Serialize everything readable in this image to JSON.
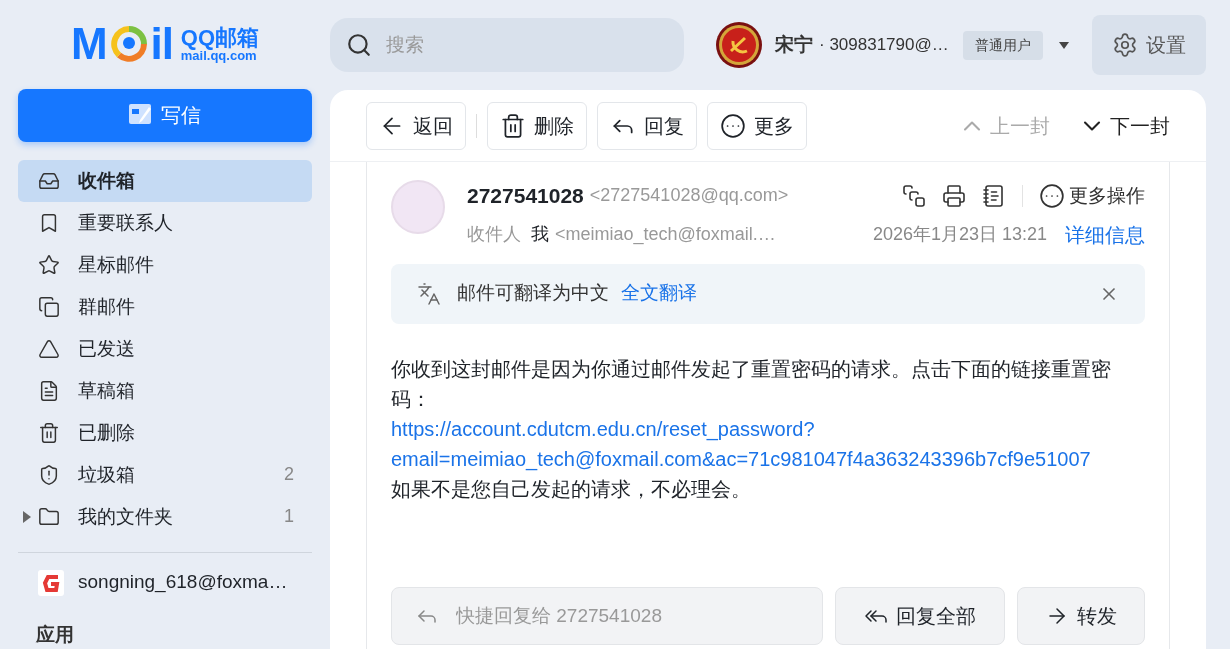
{
  "logo": {
    "left": "M",
    "right": "il",
    "name": "QQ邮箱",
    "domain": "mail.qq.com"
  },
  "search": {
    "placeholder": "搜索"
  },
  "user": {
    "name": "宋宁",
    "account": "· 309831790@…",
    "badge": "普通用户"
  },
  "settings": {
    "label": "设置"
  },
  "compose": {
    "label": "写信"
  },
  "folders": [
    {
      "kind": "inbox",
      "label": "收件箱",
      "selected": true
    },
    {
      "kind": "important",
      "label": "重要联系人",
      "selected": false
    },
    {
      "kind": "starred",
      "label": "星标邮件",
      "selected": false
    },
    {
      "kind": "group",
      "label": "群邮件",
      "selected": false
    },
    {
      "kind": "sent",
      "label": "已发送",
      "selected": false
    },
    {
      "kind": "drafts",
      "label": "草稿箱",
      "selected": false
    },
    {
      "kind": "deleted",
      "label": "已删除",
      "selected": false
    },
    {
      "kind": "spam",
      "label": "垃圾箱",
      "selected": false,
      "count": "2"
    },
    {
      "kind": "folder",
      "label": "我的文件夹",
      "selected": false,
      "count": "1",
      "expanded": false
    }
  ],
  "other_account": {
    "label": "songning_618@foxma…"
  },
  "apps_heading": "应用",
  "toolbar": {
    "buttons": [
      {
        "kind": "back",
        "label": "返回"
      },
      {
        "kind": "delete",
        "label": "删除"
      },
      {
        "kind": "reply",
        "label": "回复"
      },
      {
        "kind": "more",
        "label": "更多"
      }
    ],
    "nav": [
      {
        "kind": "prev",
        "label": "上一封",
        "disabled": true
      },
      {
        "kind": "next",
        "label": "下一封",
        "disabled": false
      }
    ]
  },
  "email": {
    "sender": "2727541028",
    "sender_address": "<2727541028@qq.com>",
    "more_actions": "更多操作",
    "to_label": "收件人",
    "to_name": "我",
    "to_address": "<meimiao_tech@foxmail.…",
    "date": "2026年1月23日 13:21",
    "details": "详细信息",
    "translate": {
      "text": "邮件可翻译为中文",
      "action": "全文翻译"
    },
    "body": [
      {
        "kind": "text",
        "text": "你收到这封邮件是因为你通过邮件发起了重置密码的请求。点击下面的链接重置密码："
      },
      {
        "kind": "link",
        "text": "https://account.cdutcm.edu.cn/reset_password?email=meimiao_tech@foxmail.com&ac=71c981047f4a363243396b7cf9e51007"
      },
      {
        "kind": "text",
        "text": "如果不是您自己发起的请求，不必理会。"
      }
    ],
    "quick_reply": {
      "placeholder": "快捷回复给 2727541028"
    },
    "actions": [
      {
        "kind": "reply_all",
        "label": "回复全部"
      },
      {
        "kind": "forward",
        "label": "转发"
      }
    ]
  }
}
